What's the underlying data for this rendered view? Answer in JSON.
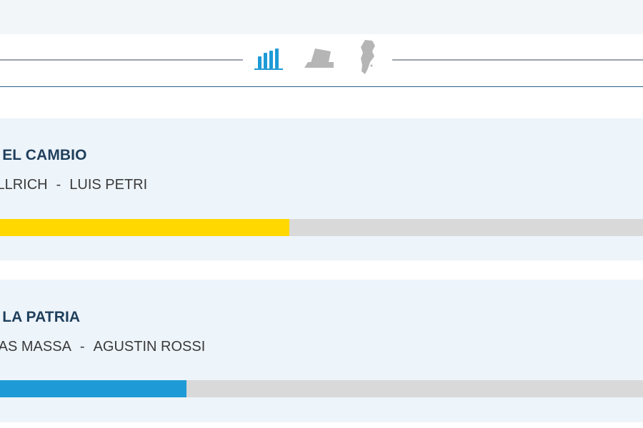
{
  "toolbar": {
    "views": [
      {
        "icon": "bar-chart-icon",
        "color": "#1e9ad6",
        "active": true
      },
      {
        "icon": "ballot-box-icon",
        "color": "#b5b5b5",
        "active": false
      },
      {
        "icon": "argentina-map-icon",
        "color": "#b5b5b5",
        "active": false
      }
    ]
  },
  "results": [
    {
      "party": "R EL CAMBIO",
      "candidate1": "ULLRICH",
      "separator": "-",
      "candidate2": "LUIS PETRI",
      "bar_color": "#ffd800",
      "share": 0.45
    },
    {
      "party": "R LA PATRIA",
      "candidate1": "MAS MASSA",
      "separator": "-",
      "candidate2": "AGUSTIN ROSSI",
      "bar_color": "#1e9ad6",
      "share": 0.29
    }
  ]
}
